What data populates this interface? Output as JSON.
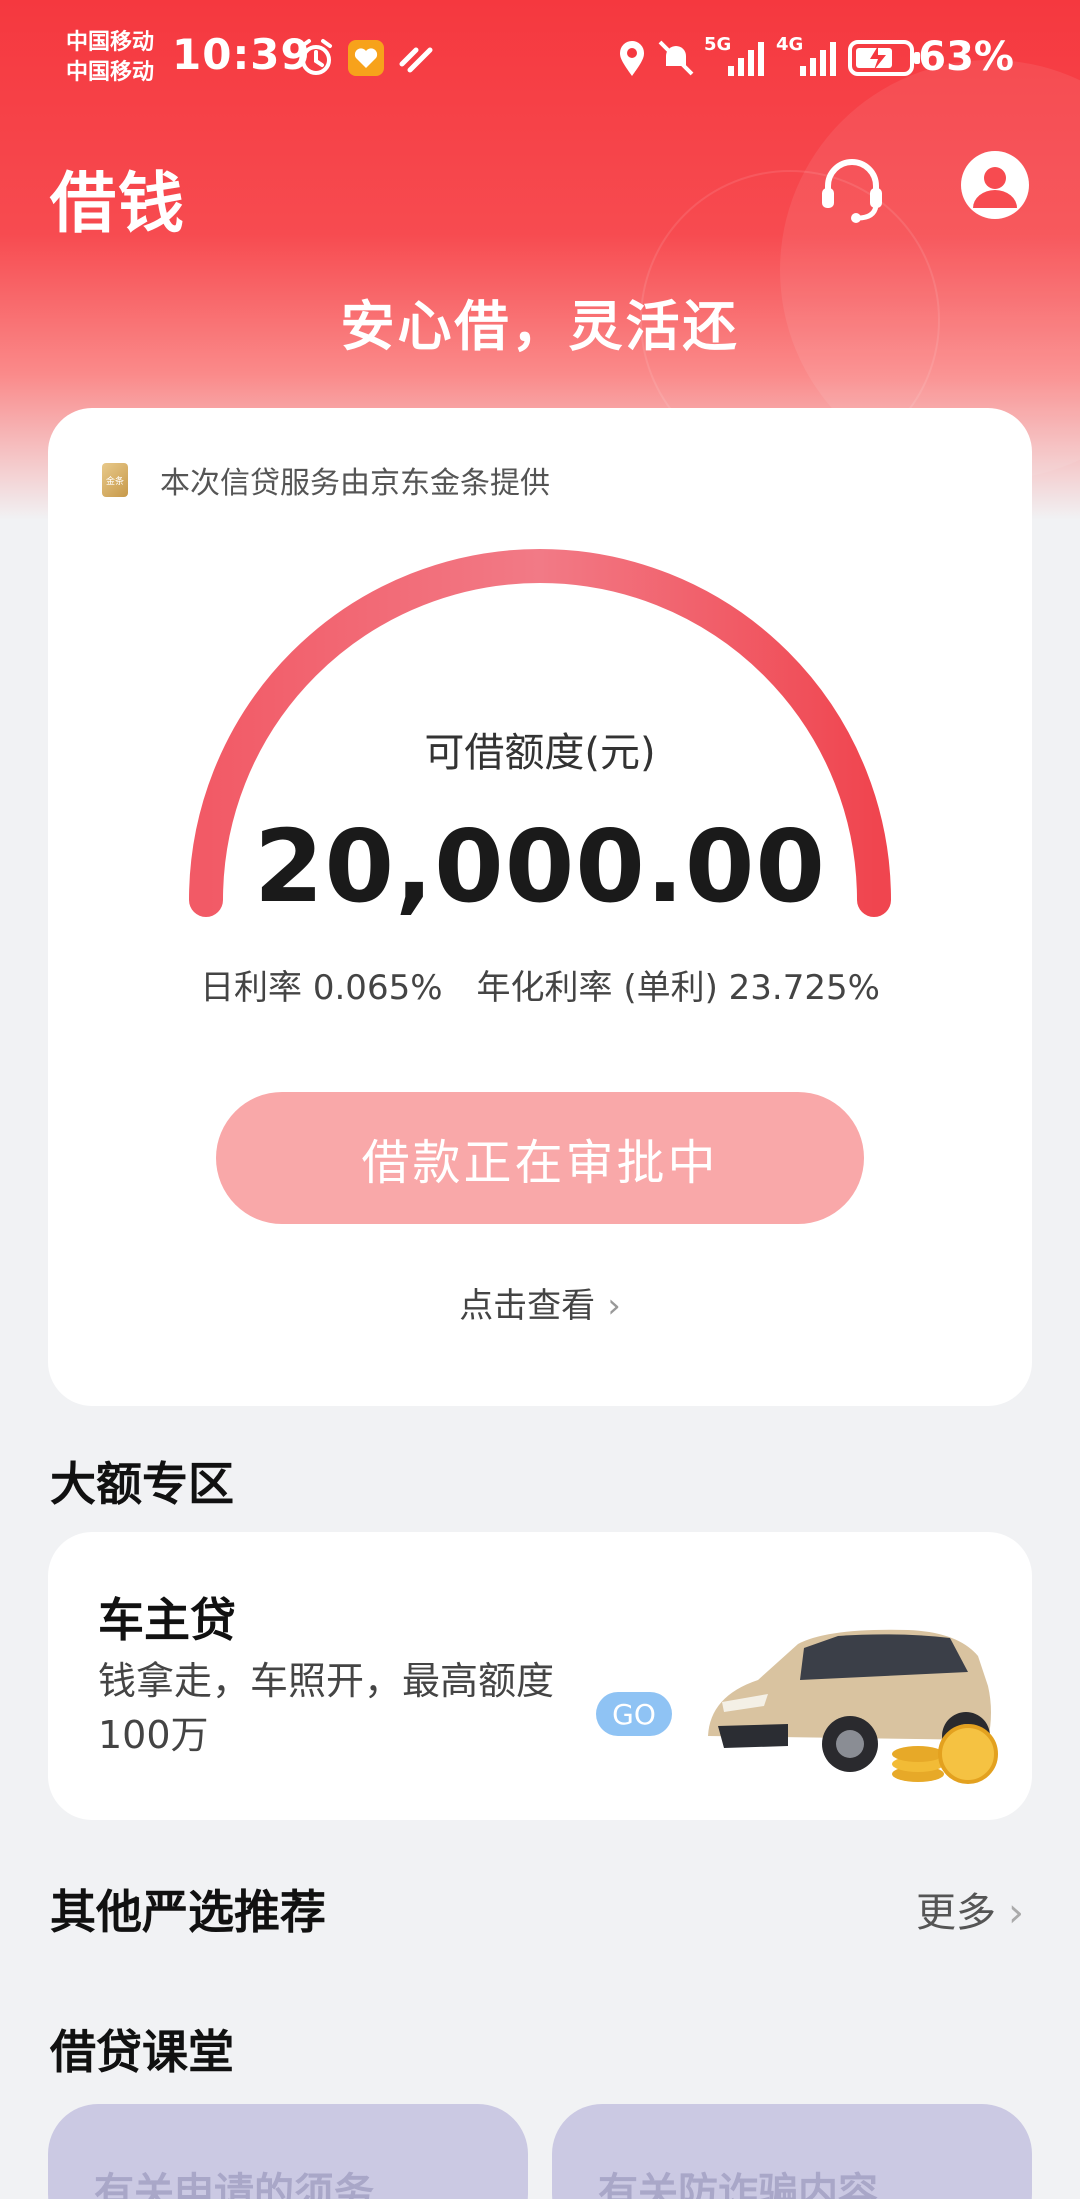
{
  "status_bar": {
    "carrier_1": "中国移动",
    "carrier_2": "中国移动",
    "time": "10:39",
    "network_1": "5G",
    "network_2": "4G",
    "battery": "63%",
    "icons": [
      "alarm-icon",
      "heart-shield-icon",
      "link-icon",
      "location-icon",
      "mute-icon",
      "signal-icon",
      "battery-icon"
    ]
  },
  "header": {
    "title": "借钱",
    "slogan": "安心借，灵活还",
    "icons": [
      "headset-icon",
      "profile-icon"
    ]
  },
  "loan_card": {
    "provider_logo": "金条",
    "provider_text": "本次信贷服务由京东金条提供",
    "quota_label": "可借额度(元)",
    "quota_value": "20,000.00",
    "daily_rate": "日利率 0.065%",
    "annual_rate": "年化利率 (单利) 23.725%",
    "status_button": "借款正在审批中",
    "view_link": "点击查看"
  },
  "large_section": {
    "title": "大额专区",
    "product_title": "车主贷",
    "product_desc": "钱拿走，车照开，最高额度100万",
    "go_label": "GO"
  },
  "recommend_section": {
    "title": "其他严选推荐",
    "more_label": "更多"
  },
  "class_section": {
    "title": "借贷课堂",
    "tiles": [
      "有关申请的须务",
      "有关防诈骗内容"
    ]
  },
  "colors": {
    "brand_red": "#f5383f",
    "button_pink": "#f9a8a9",
    "go_blue": "#8fc3f4",
    "tile_lavender": "#cbc9e3"
  }
}
